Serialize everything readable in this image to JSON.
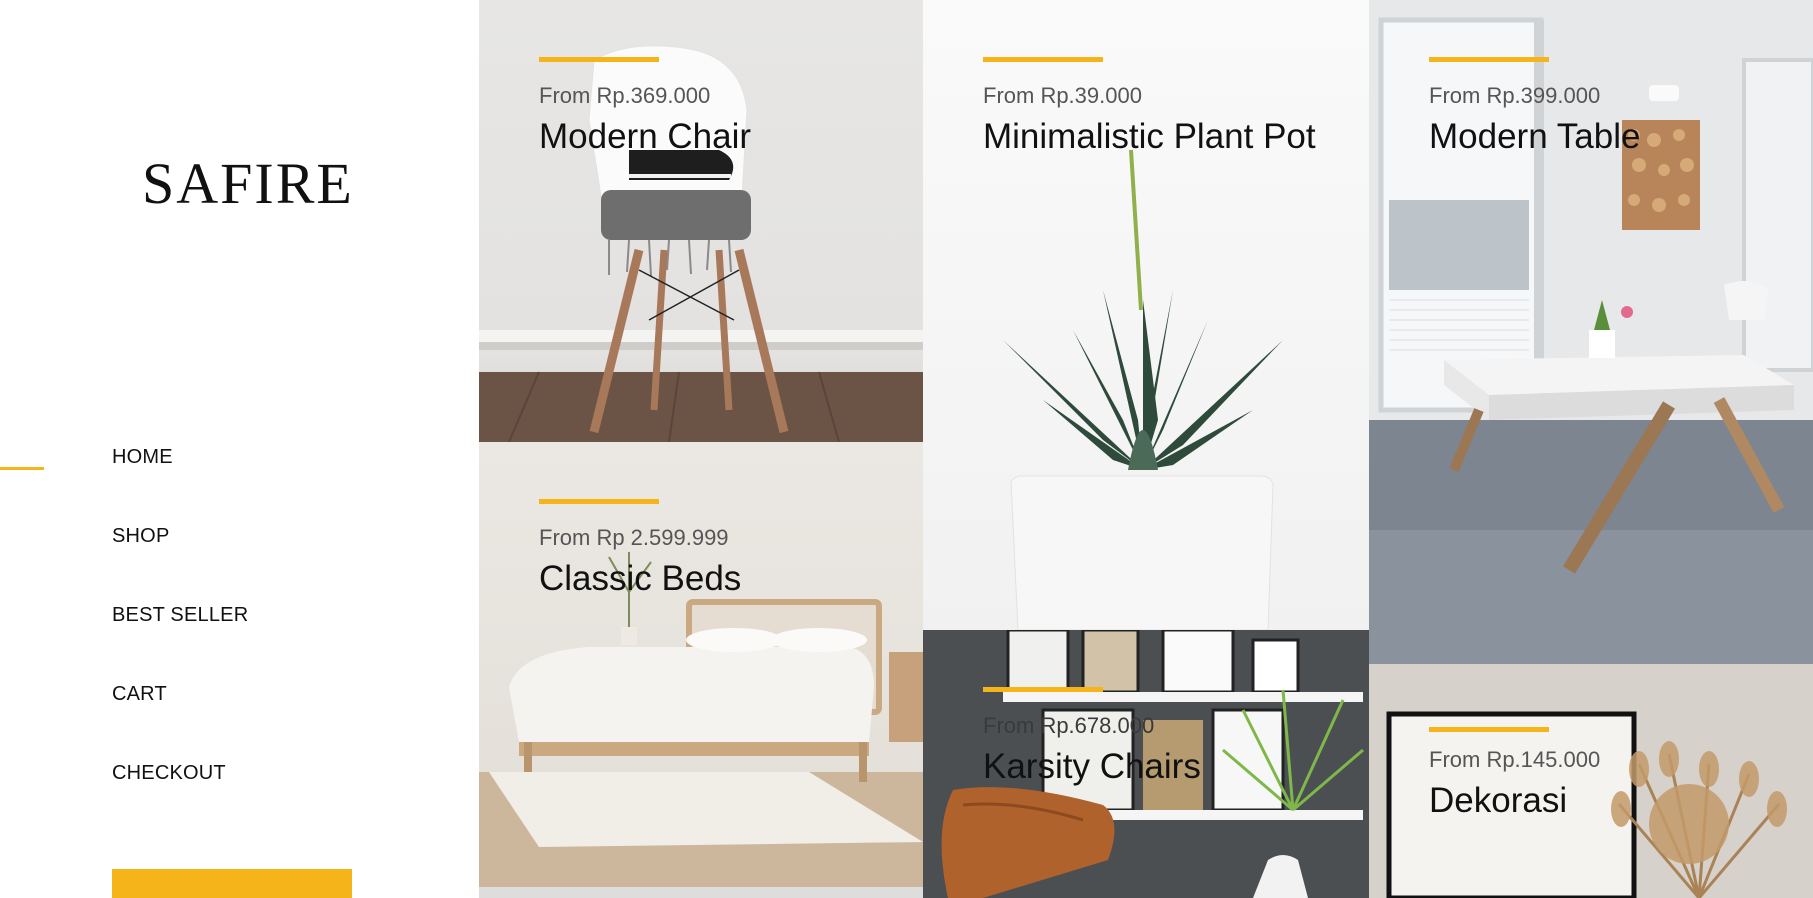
{
  "brand": {
    "logo": "SAFIRE"
  },
  "nav": {
    "items": [
      {
        "label": "HOME",
        "active": true
      },
      {
        "label": "SHOP",
        "active": false
      },
      {
        "label": "BEST SELLER",
        "active": false
      },
      {
        "label": "CART",
        "active": false
      },
      {
        "label": "CHECKOUT",
        "active": false
      }
    ]
  },
  "colors": {
    "accent": "#f4b41a",
    "text": "#111111",
    "price": "#555555"
  },
  "products": [
    {
      "price": "From Rp.369.000",
      "name": "Modern Chair"
    },
    {
      "price": "From Rp.39.000",
      "name": "Minimalistic Plant Pot"
    },
    {
      "price": "From Rp.399.000",
      "name": "Modern Table"
    },
    {
      "price": "From Rp 2.599.999",
      "name": "Classic Beds"
    },
    {
      "price": "From Rp.678.000",
      "name": "Karsity Chairs"
    },
    {
      "price": "From Rp.145.000",
      "name": "Dekorasi"
    }
  ]
}
